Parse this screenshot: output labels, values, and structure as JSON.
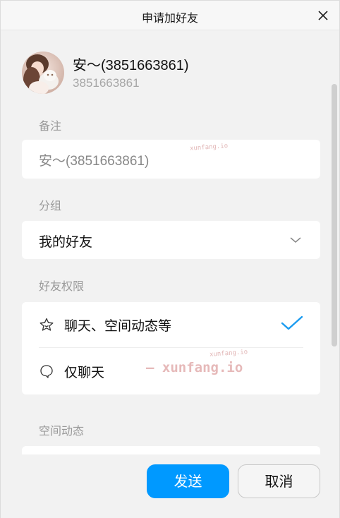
{
  "window": {
    "title": "申请加好友"
  },
  "profile": {
    "nickname": "安～(3851663861)",
    "qq_number": "3851663861"
  },
  "remark": {
    "label": "备注",
    "value": "安～(3851663861)"
  },
  "group": {
    "label": "分组",
    "selected": "我的好友"
  },
  "permissions": {
    "label": "好友权限",
    "options": [
      {
        "label": "聊天、空间动态等",
        "icon": "star-icon",
        "selected": true
      },
      {
        "label": "仅聊天",
        "icon": "chat-bubble-icon",
        "selected": false
      }
    ]
  },
  "space": {
    "label": "空间动态"
  },
  "watermarks": {
    "small_1": "xunfang.io",
    "small_2": "xunfang.io",
    "large": "— xunfang.io"
  },
  "footer": {
    "send_label": "发送",
    "cancel_label": "取消"
  },
  "colors": {
    "accent": "#0099ff",
    "check": "#1a9bf0",
    "background": "#f2f2f2",
    "card": "#ffffff"
  }
}
